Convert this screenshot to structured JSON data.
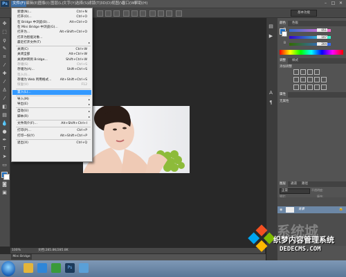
{
  "menubar": {
    "logo": "Ps",
    "items": [
      "文件(F)",
      "编辑(E)",
      "图像(I)",
      "图层(L)",
      "文字(Y)",
      "选择(S)",
      "滤镜(T)",
      "3D(D)",
      "视图(V)",
      "窗口(W)",
      "帮助(H)"
    ],
    "win_controls": [
      "–",
      "□",
      "✕"
    ]
  },
  "optionsbar": {
    "workspace": "基本功能"
  },
  "file_menu": {
    "items": [
      {
        "label": "新建(N)...",
        "shortcut": "Ctrl+N",
        "disabled": false
      },
      {
        "label": "打开(O)...",
        "shortcut": "Ctrl+O",
        "disabled": false
      },
      {
        "label": "在 Bridge 中浏览(B)...",
        "shortcut": "Alt+Ctrl+O",
        "disabled": false
      },
      {
        "label": "在 Mini Bridge 中浏览(G)...",
        "shortcut": "",
        "disabled": false
      },
      {
        "label": "打开为...",
        "shortcut": "Alt+Shift+Ctrl+O",
        "disabled": false
      },
      {
        "label": "打开为智能对象...",
        "shortcut": "",
        "disabled": false
      },
      {
        "label": "最近打开文件(T)",
        "shortcut": "",
        "disabled": false,
        "submenu": true
      },
      {
        "sep": true
      },
      {
        "label": "关闭(C)",
        "shortcut": "Ctrl+W",
        "disabled": false
      },
      {
        "label": "关闭全部",
        "shortcut": "Alt+Ctrl+W",
        "disabled": false
      },
      {
        "label": "关闭并转到 Bridge...",
        "shortcut": "Shift+Ctrl+W",
        "disabled": false
      },
      {
        "label": "存储(S)",
        "shortcut": "Ctrl+S",
        "disabled": true
      },
      {
        "label": "存储为(A)...",
        "shortcut": "Shift+Ctrl+S",
        "disabled": false
      },
      {
        "label": "签入(I)...",
        "shortcut": "",
        "disabled": true
      },
      {
        "label": "存储为 Web 所用格式...",
        "shortcut": "Alt+Shift+Ctrl+S",
        "disabled": false
      },
      {
        "label": "恢复(V)",
        "shortcut": "F12",
        "disabled": true
      },
      {
        "sep": true
      },
      {
        "label": "置入(L)...",
        "shortcut": "",
        "disabled": false,
        "highlight": true
      },
      {
        "sep": true
      },
      {
        "label": "导入(M)",
        "shortcut": "",
        "disabled": false,
        "submenu": true
      },
      {
        "label": "导出(E)",
        "shortcut": "",
        "disabled": false,
        "submenu": true
      },
      {
        "sep": true
      },
      {
        "label": "自动(U)",
        "shortcut": "",
        "disabled": false,
        "submenu": true
      },
      {
        "label": "脚本(R)",
        "shortcut": "",
        "disabled": false,
        "submenu": true
      },
      {
        "sep": true
      },
      {
        "label": "文件简介(F)...",
        "shortcut": "Alt+Shift+Ctrl+I",
        "disabled": false
      },
      {
        "sep": true
      },
      {
        "label": "打印(P)...",
        "shortcut": "Ctrl+P",
        "disabled": false
      },
      {
        "label": "打印一份(Y)",
        "shortcut": "Alt+Shift+Ctrl+P",
        "disabled": false
      },
      {
        "sep": true
      },
      {
        "label": "退出(X)",
        "shortcut": "Ctrl+Q",
        "disabled": false
      }
    ]
  },
  "color_panel": {
    "tabs": [
      "颜色",
      "色板"
    ],
    "r": "051",
    "g": "107",
    "b": "204",
    "fg_color": "#1b6ec2"
  },
  "adjust_panel": {
    "tabs": [
      "调整",
      "样式"
    ],
    "title": "添加调整"
  },
  "props_panel": {
    "tabs": [
      "属性"
    ],
    "text": "无属性"
  },
  "layers_panel": {
    "tabs": [
      "图层",
      "通道",
      "路径"
    ],
    "blend": "正常",
    "opacity_label": "不透明度:",
    "lock_label": "锁定:",
    "fill_label": "填充:",
    "layer_name": "背景"
  },
  "status": {
    "zoom": "100%",
    "doc": "文档:285.8K/285.8K"
  },
  "minibridge": {
    "tab": "Mini Bridge"
  },
  "watermark": {
    "text": "织梦内容管理系统",
    "url": "DEDECMS.COM"
  }
}
